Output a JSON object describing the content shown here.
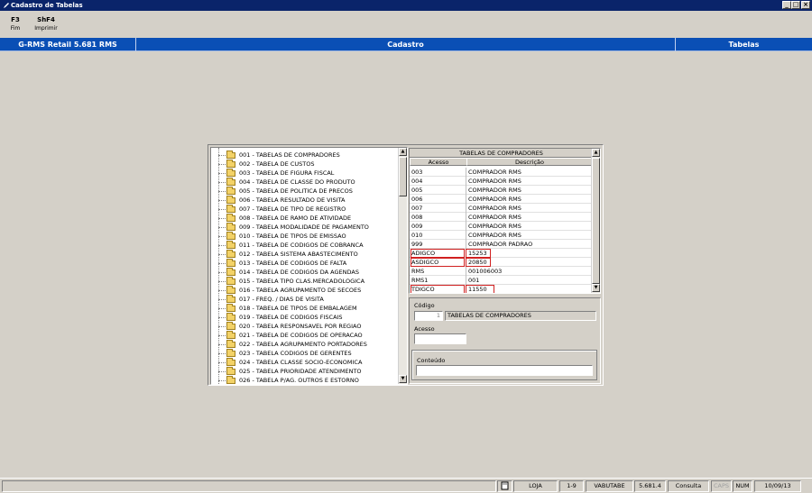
{
  "window": {
    "title": "Cadastro de Tabelas"
  },
  "fkeys": [
    {
      "key": "F3",
      "label": "Fim"
    },
    {
      "key": "ShF4",
      "label": "Imprimir"
    }
  ],
  "header": {
    "left": "G-RMS Retail 5.681 RMS",
    "center": "Cadastro",
    "right": "Tabelas"
  },
  "tree": {
    "items": [
      "001 - TABELAS DE COMPRADORES",
      "002 - TABELA DE CUSTOS",
      "003 - TABELA DE FIGURA FISCAL",
      "004 - TABELA DE CLASSE DO PRODUTO",
      "005 - TABELA DE POLITICA DE PRECOS",
      "006 - TABELA RESULTADO DE VISITA",
      "007 - TABELA DE TIPO DE REGISTRO",
      "008 - TABELA DE RAMO DE ATIVIDADE",
      "009 - TABELA MODALIDADE DE PAGAMENTO",
      "010 - TABELA DE TIPOS DE EMISSAO",
      "011 - TABELA DE CODIGOS DE COBRANCA",
      "012 - TABELA SISTEMA ABASTECIMENTO",
      "013 - TABELA DE CODIGOS DE FALTA",
      "014 - TABELA DE CODIGOS DA AGENDAS",
      "015 - TABELA TIPO CLAS.MERCADOLOGICA",
      "016 - TABELA AGRUPAMENTO DE SECOES",
      "017 - FREQ. / DIAS DE VISITA",
      "018 - TABELA DE TIPOS DE EMBALAGEM",
      "019 - TABELA DE CODIGOS FISCAIS",
      "020 - TABELA RESPONSAVEL POR REGIAO",
      "021 - TABELA DE CODIGOS DE OPERACAO",
      "022 - TABELA AGRUPAMENTO PORTADORES",
      "023 - TABELA CODIGOS DE GERENTES",
      "024 - TABELA CLASSE SOCIO-ECONOMICA",
      "025 - TABELA PRIORIDADE ATENDIMENTO",
      "026 - TABELA P/AG. OUTROS E ESTORNO"
    ]
  },
  "grid": {
    "title": "TABELAS DE COMPRADORES",
    "col_acesso": "Acesso",
    "col_descricao": "Descrição",
    "rows": [
      {
        "acesso": "003",
        "descricao": "COMPRADOR RMS"
      },
      {
        "acesso": "004",
        "descricao": "COMPRADOR RMS"
      },
      {
        "acesso": "005",
        "descricao": "COMPRADOR RMS"
      },
      {
        "acesso": "006",
        "descricao": "COMPRADOR RMS"
      },
      {
        "acesso": "007",
        "descricao": "COMPRADOR RMS"
      },
      {
        "acesso": "008",
        "descricao": "COMPRADOR RMS"
      },
      {
        "acesso": "009",
        "descricao": "COMPRADOR RMS"
      },
      {
        "acesso": "010",
        "descricao": "COMPRADOR RMS"
      },
      {
        "acesso": "999",
        "descricao": "COMPRADOR PADRAO"
      },
      {
        "acesso": "ADIGCO",
        "descricao": "15253"
      },
      {
        "acesso": "ASDIGCO",
        "descricao": "20850"
      },
      {
        "acesso": "RMS",
        "descricao": "001006003"
      },
      {
        "acesso": "RMS1",
        "descricao": "001"
      },
      {
        "acesso": "TDIGCO",
        "descricao": "11550"
      }
    ]
  },
  "form": {
    "codigo_label": "Código",
    "codigo_value": "1",
    "codigo_desc": "TABELAS DE COMPRADORES",
    "acesso_label": "Acesso",
    "acesso_value": "",
    "conteudo_label": "Conteúdo",
    "conteudo_value": ""
  },
  "status": {
    "loja": "LOJA",
    "range": "1-9",
    "program": "VABUTABE",
    "version": "5.681.4",
    "mode": "Consulta",
    "caps": "CAPS",
    "num": "NUM",
    "date": "10/09/13"
  },
  "colors": {
    "title_bar": "#0a246a",
    "header_bar": "#0a4fb5",
    "highlight_border": "#d02020"
  },
  "icons": {
    "window": "pencil-icon",
    "tree_item": "folder-icon",
    "status": "document-icon"
  }
}
